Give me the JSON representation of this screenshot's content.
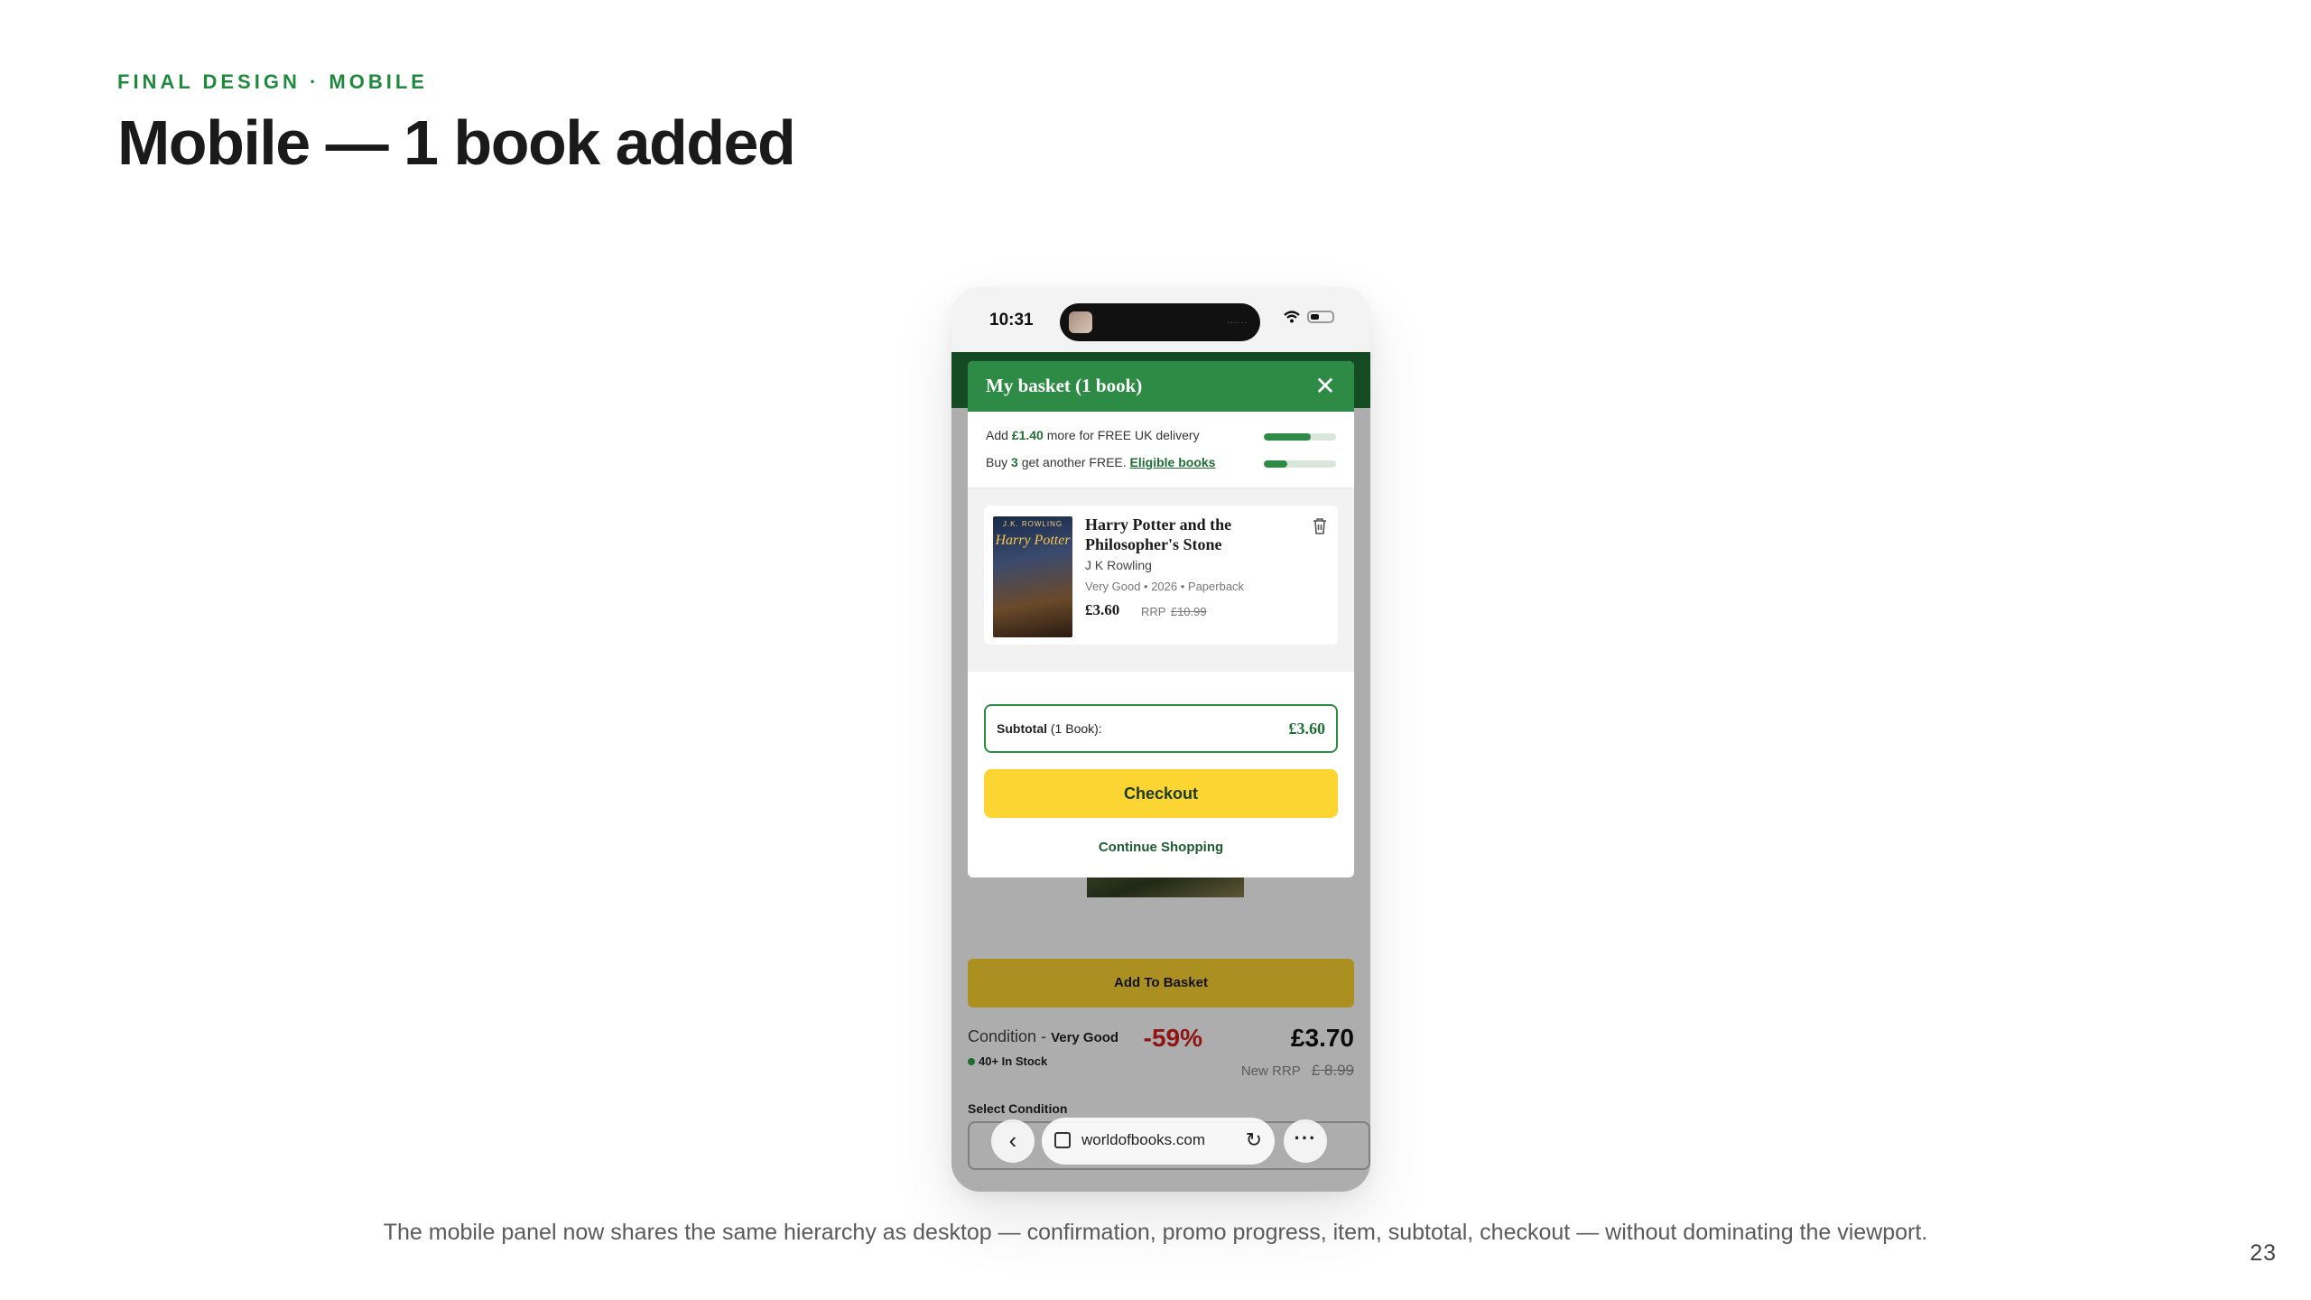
{
  "slide": {
    "eyebrow": "FINAL DESIGN · MOBILE",
    "title": "Mobile — 1 book added",
    "caption": "The mobile panel now shares the same hierarchy as desktop — confirmation, promo progress, item, subtotal, checkout — without dominating the viewport.",
    "page_number": "23"
  },
  "phone": {
    "status": {
      "time": "10:31",
      "island_dots": "......"
    },
    "background_page": {
      "add_to_basket": "Add To Basket",
      "condition_label": "Condition -",
      "condition_value": "Very Good",
      "stock": "40+ In Stock",
      "discount": "-59%",
      "price": "£3.70",
      "new_rrp_label": "New RRP",
      "new_rrp_value": "£ 8.99",
      "select_condition": "Select Condition"
    },
    "basket": {
      "title": "My basket (1 book)",
      "close_icon": "close-icon",
      "promo": [
        {
          "prefix": "Add ",
          "highlight": "£1.40",
          "suffix": " more for FREE UK delivery",
          "link": "",
          "progress": 0.65
        },
        {
          "prefix": "Buy ",
          "highlight": "3",
          "suffix": " get another FREE. ",
          "link": "Eligible books",
          "progress": 0.33
        }
      ],
      "item": {
        "cover_top": "J.K. ROWLING",
        "cover_title": "Harry Potter",
        "title": "Harry Potter and the Philosopher's Stone",
        "author": "J K Rowling",
        "meta": "Very Good • 2026 • Paperback",
        "price": "£3.60",
        "rrp_label": "RRP",
        "rrp_value": "£10.99"
      },
      "subtotal_label": "Subtotal",
      "subtotal_count": " (1 Book):",
      "subtotal_value": "£3.60",
      "checkout": "Checkout",
      "continue": "Continue Shopping"
    },
    "browser": {
      "domain": "worldofbooks.com",
      "more": "···"
    }
  },
  "colors": {
    "brand_green": "#2e8b45",
    "checkout_yellow": "#fcd532",
    "discount_red": "#d31f1f"
  }
}
